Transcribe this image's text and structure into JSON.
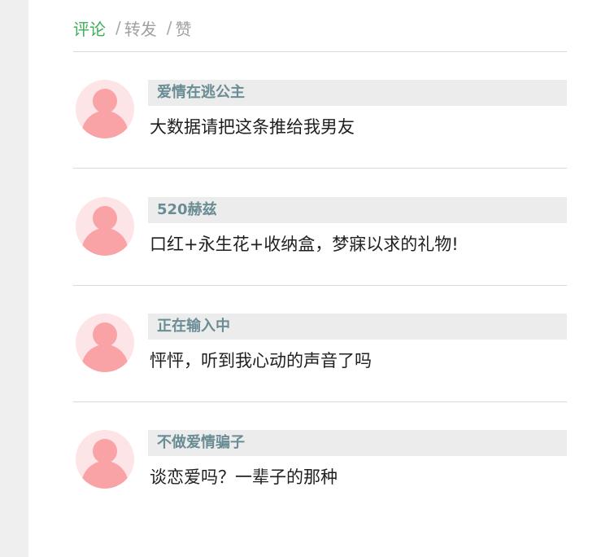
{
  "tabs": {
    "comment": "评论",
    "forward": "转发",
    "like": "赞",
    "separator": "/"
  },
  "comments": [
    {
      "username": "爱情在逃公主",
      "text": "大数据请把这条推给我男友"
    },
    {
      "username": "520赫兹",
      "text": "口红+永生花+收纳盒，梦寐以求的礼物!"
    },
    {
      "username": "正在输入中",
      "text": "怦怦，听到我心动的声音了吗"
    },
    {
      "username": "不做爱情骗子",
      "text": "谈恋爱吗？一辈子的那种"
    }
  ],
  "colors": {
    "active_tab": "#3fae5a",
    "username": "#6a8d95",
    "avatar_bg": "#fde4e6",
    "avatar_figure": "#f9a3a7"
  }
}
